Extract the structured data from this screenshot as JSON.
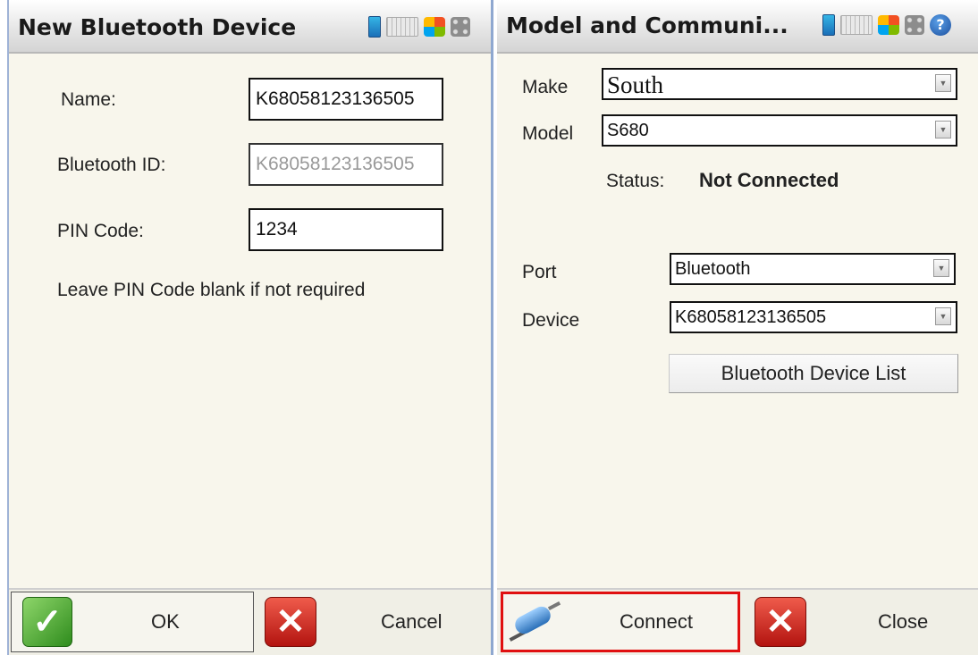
{
  "left_window": {
    "title": "New Bluetooth Device",
    "tray_icons": [
      "battery-icon",
      "keyboard-icon",
      "windows-flag-icon",
      "grid-icon"
    ],
    "form": {
      "name_label": "Name:",
      "name_value": "K68058123136505",
      "bluetooth_id_label": "Bluetooth ID:",
      "bluetooth_id_value": "K68058123136505",
      "pin_label": "PIN Code:",
      "pin_value": "1234",
      "hint": "Leave PIN Code blank if not required"
    },
    "buttons": {
      "ok_label": "OK",
      "cancel_label": "Cancel"
    }
  },
  "right_window": {
    "title": "Model and Communi...",
    "tray_icons": [
      "battery-icon",
      "keyboard-icon",
      "windows-flag-icon",
      "grid-icon",
      "help-icon"
    ],
    "help_glyph": "?",
    "form": {
      "make_label": "Make",
      "make_value": "South",
      "model_label": "Model",
      "model_value": "S680",
      "status_label": "Status:",
      "status_value": "Not Connected",
      "port_label": "Port",
      "port_value": "Bluetooth",
      "device_label": "Device",
      "device_value": "K68058123136505",
      "device_list_button": "Bluetooth Device List"
    },
    "buttons": {
      "connect_label": "Connect",
      "close_label": "Close"
    },
    "highlight_color": "#e01010"
  }
}
